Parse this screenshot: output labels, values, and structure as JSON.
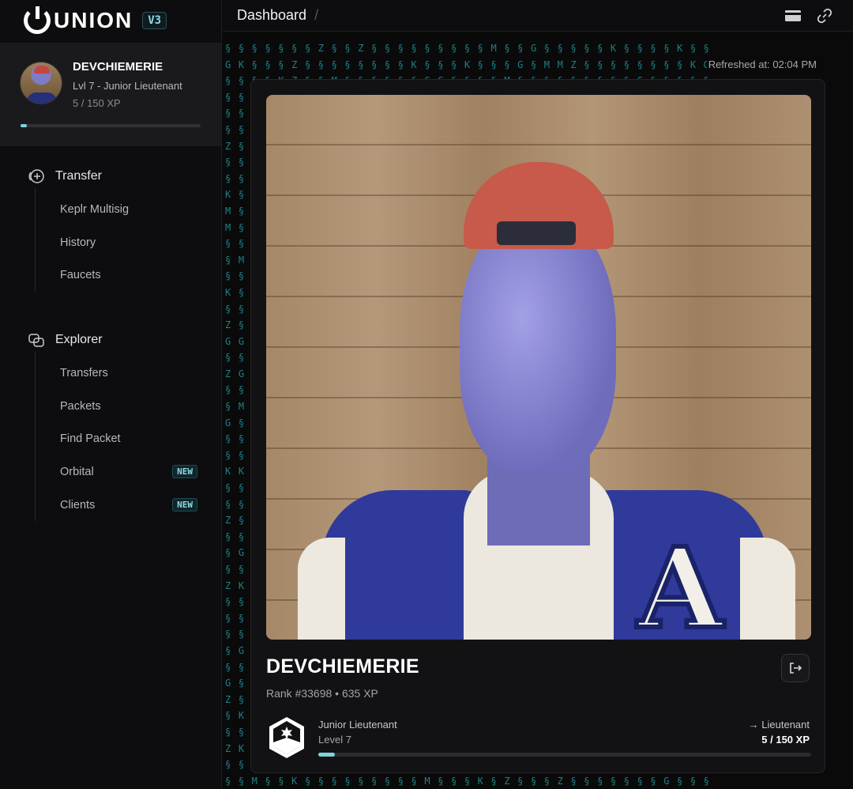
{
  "brand": {
    "name": "UNION",
    "version": "V3"
  },
  "profile": {
    "name": "DEVCHIEMERIE",
    "level_line": "Lvl 7 - Junior Lieutenant",
    "xp_line": "5 / 150 XP",
    "progress": 0.033
  },
  "nav": {
    "transfer": {
      "label": "Transfer",
      "icon": "plus-circle-icon",
      "items": [
        {
          "label": "Keplr Multisig"
        },
        {
          "label": "History"
        },
        {
          "label": "Faucets"
        }
      ]
    },
    "explorer": {
      "label": "Explorer",
      "icon": "explorer-icon",
      "items": [
        {
          "label": "Transfers"
        },
        {
          "label": "Packets"
        },
        {
          "label": "Find Packet"
        },
        {
          "label": "Orbital",
          "badge": "NEW"
        },
        {
          "label": "Clients",
          "badge": "NEW"
        }
      ]
    }
  },
  "header": {
    "breadcrumb": "Dashboard",
    "separator": "/",
    "icons": [
      "wallet-icon",
      "link-icon"
    ]
  },
  "refreshed": "Refreshed at: 02:04 PM",
  "card": {
    "name": "DEVCHIEMERIE",
    "rank_line": "Rank #33698 • 635 XP",
    "current_rank": "Junior Lieutenant",
    "current_level": "Level 7",
    "next_rank": "→ Lieutenant",
    "xp_progress_text": "5 / 150 XP",
    "progress": 0.033
  },
  "colors": {
    "accent": "#7ed2dd",
    "matrix": "#1f7f86",
    "background": "#0a0a0b"
  }
}
